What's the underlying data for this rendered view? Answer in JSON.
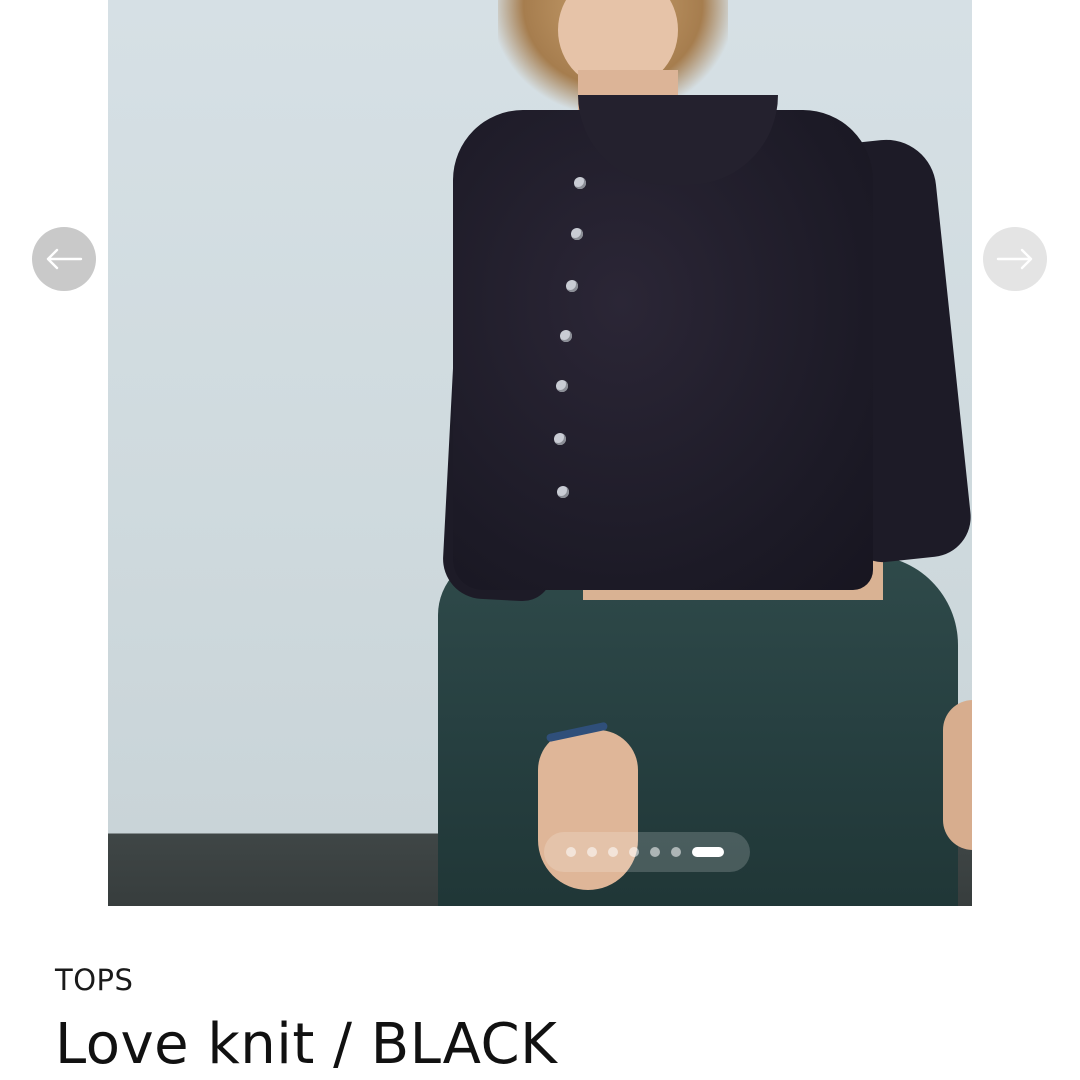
{
  "gallery": {
    "image_alt": "Model wearing black knit cardigan with dark green skirt",
    "prev_icon": "arrow-left-icon",
    "next_icon": "arrow-right-icon",
    "slide_count": 7,
    "active_slide": 7
  },
  "product": {
    "category": "TOPS",
    "title": "Love knit / BLACK"
  }
}
